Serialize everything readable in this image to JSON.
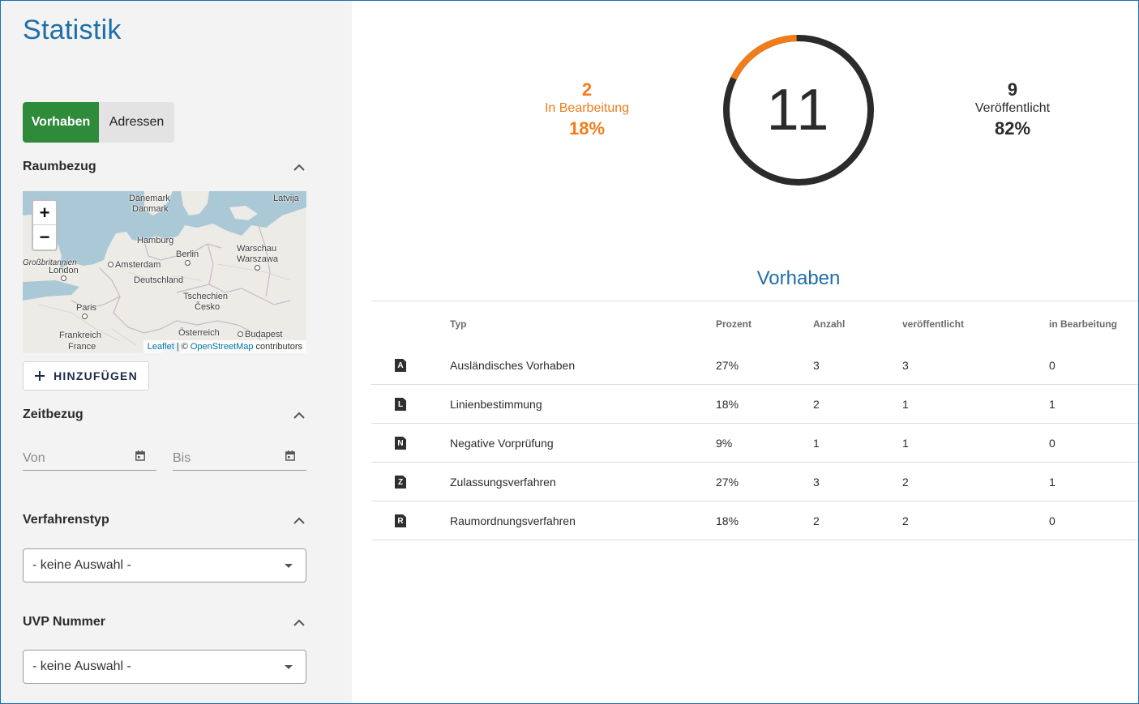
{
  "page_title": "Statistik",
  "toggle": {
    "active": "Vorhaben",
    "inactive": "Adressen"
  },
  "sections": {
    "raumbezug": "Raumbezug",
    "zeitbezug": "Zeitbezug",
    "verfahrenstyp": "Verfahrenstyp",
    "uvp_nummer": "UVP Nummer"
  },
  "map": {
    "labels": {
      "daenemark": "Dänemark",
      "danmark": "Danmark",
      "latvija": "Latvija",
      "hamburg": "Hamburg",
      "berlin": "Berlin",
      "warschau": "Warschau",
      "warszawa": "Warszawa",
      "grossbritannien": "Großbritannien",
      "london": "London",
      "amsterdam": "Amsterdam",
      "deutschland": "Deutschland",
      "tschechien": "Tschechien",
      "cesko": "Česko",
      "paris": "Paris",
      "frankreich": "Frankreich",
      "france": "France",
      "oesterreich": "Österreich",
      "budapest": "Budapest"
    },
    "zoom_in": "+",
    "zoom_out": "−",
    "attribution": {
      "leaflet": "Leaflet",
      "sep": "| ©",
      "osm": "OpenStreetMap",
      "contrib": "contributors"
    }
  },
  "add_button": "HINZUFÜGEN",
  "date": {
    "from_placeholder": "Von",
    "to_placeholder": "Bis"
  },
  "verfahrenstyp_select": "- keine Auswahl -",
  "uvp_select": "- keine Auswahl -",
  "stats": {
    "total": "11",
    "in_progress": {
      "count": "2",
      "label": "In Bearbeitung",
      "percent": "18%",
      "fraction": 0.18
    },
    "published": {
      "count": "9",
      "label": "Veröffentlicht",
      "percent": "82%"
    }
  },
  "colors": {
    "accent": "#f07d1a",
    "ring": "#2b2b2b",
    "brand_blue": "#1e6fa8",
    "active_green": "#2e8b3a"
  },
  "table": {
    "title": "Vorhaben",
    "headers": {
      "typ": "Typ",
      "prozent": "Prozent",
      "anzahl": "Anzahl",
      "veroeffentlicht": "veröffentlicht",
      "in_bearbeitung": "in Bearbeitung"
    },
    "rows": [
      {
        "badge": "A",
        "typ": "Ausländisches Vorhaben",
        "prozent": "27%",
        "anzahl": "3",
        "veroeffentlicht": "3",
        "in_bearbeitung": "0"
      },
      {
        "badge": "L",
        "typ": "Linienbestimmung",
        "prozent": "18%",
        "anzahl": "2",
        "veroeffentlicht": "1",
        "in_bearbeitung": "1"
      },
      {
        "badge": "N",
        "typ": "Negative Vorprüfung",
        "prozent": "9%",
        "anzahl": "1",
        "veroeffentlicht": "1",
        "in_bearbeitung": "0"
      },
      {
        "badge": "Z",
        "typ": "Zulassungsverfahren",
        "prozent": "27%",
        "anzahl": "3",
        "veroeffentlicht": "2",
        "in_bearbeitung": "1"
      },
      {
        "badge": "R",
        "typ": "Raumordnungsverfahren",
        "prozent": "18%",
        "anzahl": "2",
        "veroeffentlicht": "2",
        "in_bearbeitung": "0"
      }
    ]
  }
}
